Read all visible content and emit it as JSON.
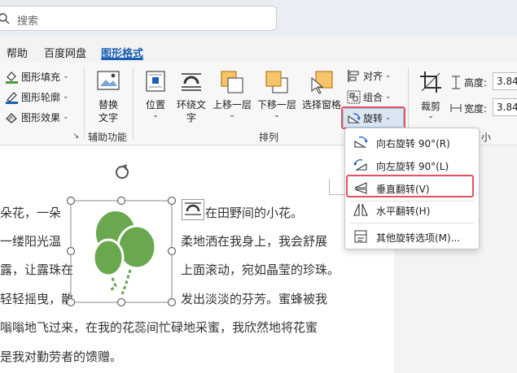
{
  "search": {
    "placeholder": "搜索"
  },
  "tabs": [
    {
      "label": "帮助"
    },
    {
      "label": "百度网盘"
    },
    {
      "label": "图形格式",
      "active": true
    }
  ],
  "ribbon": {
    "shape_styles": {
      "fill": "图形填充",
      "outline": "图形轮廓",
      "effects": "图形效果"
    },
    "accessibility": {
      "alt_text_line1": "替换",
      "alt_text_line2": "文字",
      "group_label": "辅助功能"
    },
    "arrange": {
      "position": "位置",
      "wrap_text_line1": "环绕文",
      "wrap_text_line2": "字",
      "bring_forward": "上移一层",
      "send_backward": "下移一层",
      "selection_pane": "选择窗格",
      "align": "对齐",
      "group": "组合",
      "rotate": "旋转",
      "group_label": "排列"
    },
    "size": {
      "crop": "裁剪",
      "height_label": "高度:",
      "height_value": "3.84",
      "width_label": "宽度:",
      "width_value": "3.84",
      "group_label_partial": "小"
    }
  },
  "rotate_menu": {
    "items": [
      {
        "label": "向右旋转 90°(R)",
        "icon": "rotate-right-icon"
      },
      {
        "label": "向左旋转 90°(L)",
        "icon": "rotate-left-icon"
      },
      {
        "label": "垂直翻转(V)",
        "icon": "flip-vertical-icon",
        "highlighted": true
      },
      {
        "label": "水平翻转(H)",
        "icon": "flip-horizontal-icon"
      },
      {
        "label": "其他旋转选项(M)...",
        "icon": "more-rotation-icon"
      }
    ]
  },
  "document": {
    "lines": [
      {
        "left": "朵花，一朵",
        "right": "在田野间的小花。"
      },
      {
        "left": "一缕阳光温",
        "right": "柔地洒在我身上，我会舒展"
      },
      {
        "left": "露，让露珠在",
        "right": "上面滚动，宛如晶莹的珍珠。"
      },
      {
        "left": "轻轻摇曳，散",
        "right": "发出淡淡的芬芳。蜜蜂被我"
      },
      {
        "full": "嗡嗡地飞过来，在我的花蕊间忙碌地采蜜，我欣然地将花蜜"
      },
      {
        "full": "是我对勤劳者的馈赠。"
      }
    ]
  },
  "colors": {
    "accent": "#1a5fb4",
    "balloon_green": "#6aa84f",
    "highlight_red": "#e05260"
  }
}
